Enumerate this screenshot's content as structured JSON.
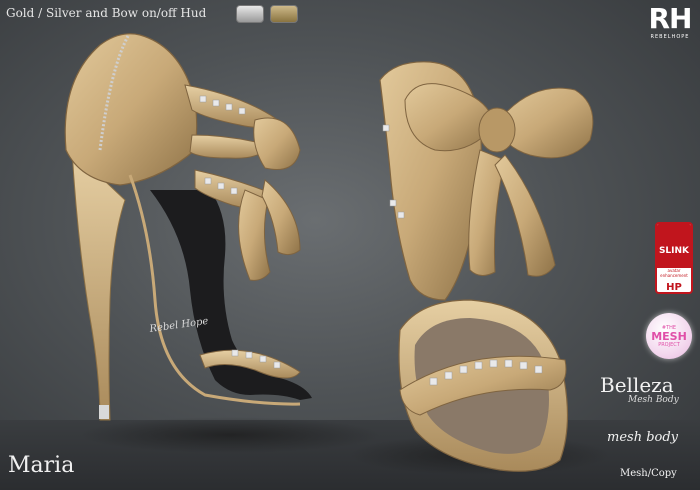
{
  "hud": {
    "title": "Gold / Silver and Bow on/off Hud",
    "swatches": [
      "silver",
      "gold"
    ]
  },
  "brand": {
    "letters": "RH",
    "subtitle": "REBELHOPE"
  },
  "badges": {
    "slink": {
      "name": "SLINK",
      "subtitle": "avatar enhancement",
      "mark": "HP"
    },
    "mesh": {
      "line1": "#THE",
      "line2": "MESH",
      "line3": "PROJECT"
    }
  },
  "belleza": {
    "title": "Belleza",
    "subtitle": "Mesh Body"
  },
  "tmesh": "mesh body",
  "license": "Mesh/Copy",
  "product": {
    "name": "Maria",
    "sole_print": "Rebel Hope"
  },
  "colors": {
    "leather": "#c8a978",
    "sole": "#1c1c1e",
    "studs": "#e9e9ea",
    "background": "#4f5356"
  }
}
